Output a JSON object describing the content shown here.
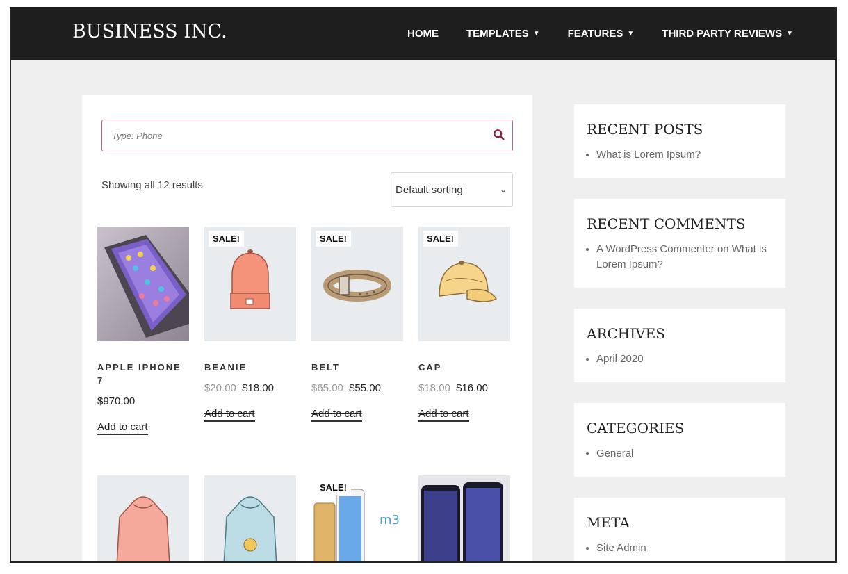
{
  "header": {
    "logo": "BUSINESS INC.",
    "nav": [
      {
        "label": "HOME",
        "has_dropdown": false
      },
      {
        "label": "TEMPLATES",
        "has_dropdown": true
      },
      {
        "label": "FEATURES",
        "has_dropdown": true
      },
      {
        "label": "THIRD PARTY REVIEWS",
        "has_dropdown": true
      }
    ]
  },
  "shop": {
    "search_placeholder": "Type: Phone",
    "results_count": "Showing all 12 results",
    "sorting": "Default sorting",
    "products": [
      {
        "name": "APPLE IPHONE 7",
        "price": "$970.00",
        "old_price": "",
        "sale": false,
        "add_to_cart": "Add to cart",
        "image": "phone"
      },
      {
        "name": "BEANIE",
        "price": "$18.00",
        "old_price": "$20.00",
        "sale": true,
        "sale_label": "SALE!",
        "add_to_cart": "Add to cart",
        "image": "beanie"
      },
      {
        "name": "BELT",
        "price": "$55.00",
        "old_price": "$65.00",
        "sale": true,
        "sale_label": "SALE!",
        "add_to_cart": "Add to cart",
        "image": "belt"
      },
      {
        "name": "CAP",
        "price": "$16.00",
        "old_price": "$18.00",
        "sale": true,
        "sale_label": "SALE!",
        "add_to_cart": "Add to cart",
        "image": "cap"
      },
      {
        "name": "",
        "price": "",
        "old_price": "",
        "sale": false,
        "add_to_cart": "",
        "image": "hoodie-pink"
      },
      {
        "name": "",
        "price": "",
        "old_price": "",
        "sale": false,
        "add_to_cart": "",
        "image": "hoodie-blue"
      },
      {
        "name": "",
        "price": "",
        "old_price": "",
        "sale": true,
        "sale_label": "SALE!",
        "add_to_cart": "",
        "image": "phones-m3"
      },
      {
        "name": "",
        "price": "",
        "old_price": "",
        "sale": false,
        "add_to_cart": "",
        "image": "phones-dark"
      }
    ]
  },
  "sidebar": {
    "recent_posts": {
      "title": "RECENT POSTS",
      "items": [
        "What is Lorem Ipsum?"
      ]
    },
    "recent_comments": {
      "title": "RECENT COMMENTS",
      "author": "A WordPress Commenter",
      "on": "on",
      "post": "What is Lorem Ipsum?"
    },
    "archives": {
      "title": "ARCHIVES",
      "items": [
        "April 2020"
      ]
    },
    "categories": {
      "title": "CATEGORIES",
      "items": [
        "General"
      ]
    },
    "meta": {
      "title": "META",
      "items": [
        "Site Admin"
      ]
    }
  },
  "colors": {
    "header_bg": "#1e1e1e",
    "page_bg": "#efefef",
    "search_border": "#b56576",
    "search_icon": "#8b1e3f"
  }
}
